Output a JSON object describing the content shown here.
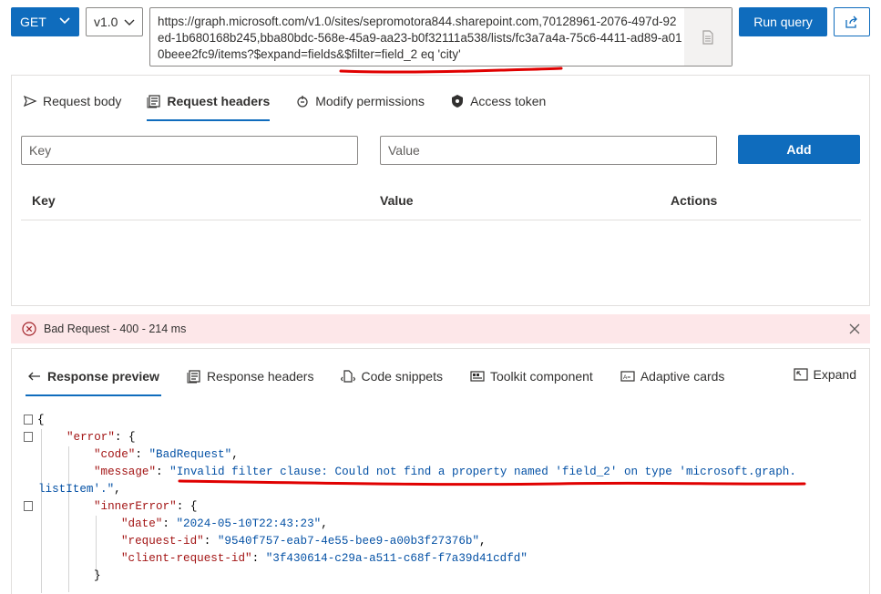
{
  "query": {
    "method": "GET",
    "version": "v1.0",
    "url": "https://graph.microsoft.com/v1.0/sites/sepromotora844.sharepoint.com,70128961-2076-497d-92ed-1b680168b245,bba80bdc-568e-45a9-aa23-b0f32111a538/lists/fc3a7a4a-75c6-4411-ad89-a010beee2fc9/items?$expand=fields&$filter=field_2 eq 'city'",
    "run_label": "Run query",
    "share_icon": "share-icon",
    "url_side_icon": "document-icon"
  },
  "request": {
    "tabs": [
      {
        "label": "Request body",
        "icon": "send-icon",
        "active": false
      },
      {
        "label": "Request headers",
        "icon": "headers-icon",
        "active": true
      },
      {
        "label": "Modify permissions",
        "icon": "lock-icon",
        "active": false
      },
      {
        "label": "Access token",
        "icon": "shield-icon",
        "active": false
      }
    ],
    "key_placeholder": "Key",
    "value_placeholder": "Value",
    "add_label": "Add",
    "columns": [
      "Key",
      "Value",
      "Actions"
    ]
  },
  "status": {
    "text": "Bad Request - 400 - 214 ms",
    "color": "#fde7e9"
  },
  "response": {
    "tabs": [
      {
        "label": "Response preview",
        "icon": "back-arrow-icon",
        "active": true
      },
      {
        "label": "Response headers",
        "icon": "headers-icon",
        "active": false
      },
      {
        "label": "Code snippets",
        "icon": "code-icon",
        "active": false
      },
      {
        "label": "Toolkit component",
        "icon": "toolkit-icon",
        "active": false
      },
      {
        "label": "Adaptive cards",
        "icon": "card-icon",
        "active": false
      }
    ],
    "expand_label": "Expand",
    "json": {
      "open_brace": "{",
      "error_key": "\"error\"",
      "code_key": "\"code\"",
      "code_value": "\"BadRequest\"",
      "message_key": "\"message\"",
      "message_value_line1": "\"Invalid filter clause: Could not find a property named 'field_2' on type 'microsoft.graph.",
      "message_value_line2": "listItem'.\"",
      "inner_error_key": "\"innerError\"",
      "date_key": "\"date\"",
      "date_value": "\"2024-05-10T22:43:23\"",
      "request_id_key": "\"request-id\"",
      "request_id_value": "\"9540f757-eab7-4e55-bee9-a00b3f27376b\"",
      "client_request_id_key": "\"client-request-id\"",
      "client_request_id_value": "\"3f430614-c29a-a511-c68f-f7a39d41cdfd\"",
      "close_brace": "}"
    }
  },
  "colors": {
    "accent": "#0f6cbd",
    "error_bg": "#fde7e9",
    "annotation": "#e00000"
  }
}
